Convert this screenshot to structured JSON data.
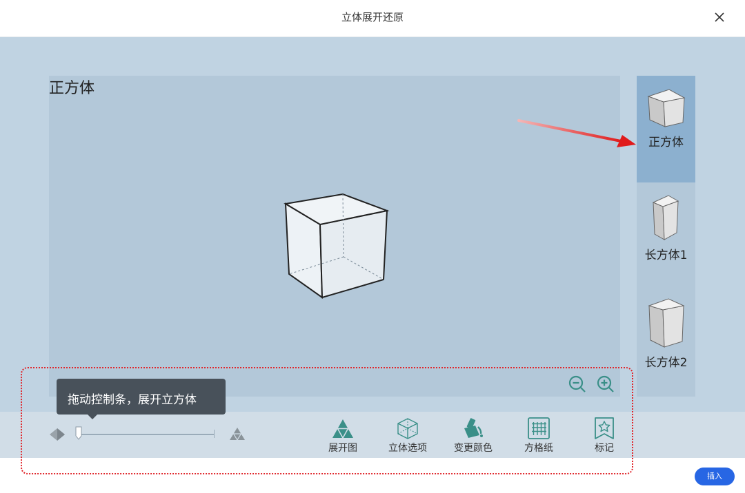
{
  "dialog": {
    "title": "立体展开还原"
  },
  "canvas": {
    "shape_name": "正方体"
  },
  "sidebar": {
    "items": [
      {
        "label": "正方体",
        "active": true
      },
      {
        "label": "长方体1",
        "active": false
      },
      {
        "label": "长方体2",
        "active": false
      }
    ]
  },
  "tooltip": {
    "text": "拖动控制条，展开立方体"
  },
  "slider": {
    "value": 0
  },
  "toolbar": {
    "tools": [
      {
        "label": "展开图",
        "icon": "unfold-triangle-icon"
      },
      {
        "label": "立体选项",
        "icon": "cube-wireframe-icon"
      },
      {
        "label": "变更颜色",
        "icon": "paint-bucket-icon"
      },
      {
        "label": "方格纸",
        "icon": "grid-paper-icon"
      },
      {
        "label": "标记",
        "icon": "star-bookmark-icon"
      }
    ]
  },
  "footer": {
    "insert_label": "插入"
  },
  "colors": {
    "accent": "#2766e4",
    "icon_teal": "#3a8f88",
    "annotation_red": "#e0262b"
  }
}
